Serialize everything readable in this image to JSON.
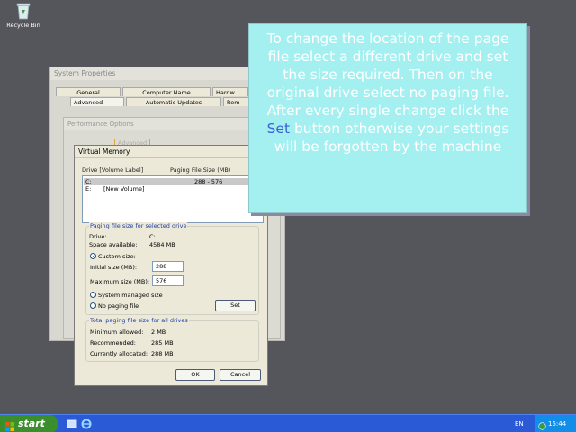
{
  "desktop": {
    "recycle_bin_label": "Recycle Bin"
  },
  "system_properties": {
    "title": "System Properties",
    "tabs_top": [
      "General",
      "Computer Name",
      "Hardw"
    ],
    "tabs_bottom": [
      "Advanced",
      "Automatic Updates",
      "Rem"
    ]
  },
  "performance_options": {
    "title": "Performance Options",
    "tab_fragment": "Advanced"
  },
  "virtual_memory": {
    "title": "Virtual Memory",
    "help": "?",
    "header_drive": "Drive  [Volume Label]",
    "header_size": "Paging File Size (MB)",
    "drives": [
      {
        "drive": "C:",
        "label": "",
        "size": "288 - 576"
      },
      {
        "drive": "E:",
        "label": "[New Volume]",
        "size": ""
      }
    ],
    "selected_group": {
      "label": "Paging file size for selected drive",
      "drive_label": "Drive:",
      "drive_value": "C:",
      "space_label": "Space available:",
      "space_value": "4584 MB",
      "custom_size": "Custom size:",
      "initial_label": "Initial size (MB):",
      "initial_value": "288",
      "max_label": "Maximum size (MB):",
      "max_value": "576",
      "system_managed": "System managed size",
      "no_paging": "No paging file",
      "set_button": "Set"
    },
    "total_group": {
      "label": "Total paging file size for all drives",
      "min_label": "Minimum allowed:",
      "min_value": "2 MB",
      "rec_label": "Recommended:",
      "rec_value": "285 MB",
      "cur_label": "Currently allocated:",
      "cur_value": "288 MB"
    },
    "ok_button": "OK",
    "cancel_button": "Cancel"
  },
  "note": {
    "text_before": "To change the location of the page file select a different drive and set the size required. Then on the original drive select no paging file. After every single change click the ",
    "highlight": "Set",
    "text_after": " button otherwise your settings will be forgotten by the machine"
  },
  "taskbar": {
    "start_label": "start",
    "language": "EN",
    "clock": "15:44"
  }
}
